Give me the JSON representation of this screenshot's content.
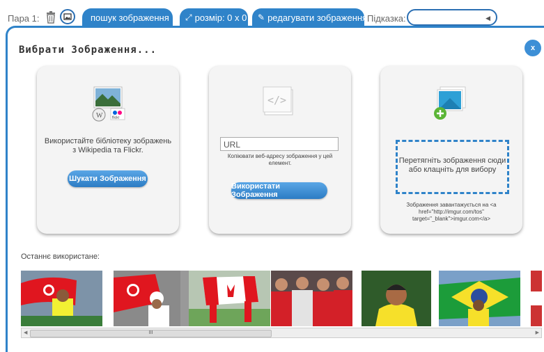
{
  "toolbar": {
    "pair_label": "Пара 1:",
    "search_image": "пошук зображення",
    "size": "розмір: 0 x 0",
    "edit_image": "редагувати зображення",
    "hint_label": "Підказка:",
    "hint_value": "",
    "accent": "#2f83c9"
  },
  "dialog": {
    "title": "Вибрати Зображення...",
    "close_label": "x",
    "library": {
      "description": [
        "Використайте бібліотеку зображень",
        "з Wikipedia та Flickr."
      ],
      "button": "Шукати Зображення",
      "logo_caption": "flickr"
    },
    "url": {
      "placeholder": "URL",
      "value": "",
      "description": [
        "Копіювати веб-адресу зображення у цей",
        "елемент."
      ],
      "button": "Використати Зображення"
    },
    "upload": {
      "dropzone": [
        "Перетягніть зображення сюди",
        "або клацніть для вибору"
      ],
      "note": [
        "Зображення завантажується на <a",
        "href=\"http://imgur.com/tos\"",
        "target=\"_blank\">imgur.com</a>"
      ]
    },
    "recent": {
      "label": "Останнє використане:",
      "thumbnails": [
        "tennis-player-tunisia-flag",
        "tennis-player-tunisia-flag-2",
        "canada-flag-runners",
        "canada-team-medals",
        "brazil-footballer-portrait",
        "brazil-flag-athlete"
      ]
    },
    "scroll_grip": "III"
  }
}
